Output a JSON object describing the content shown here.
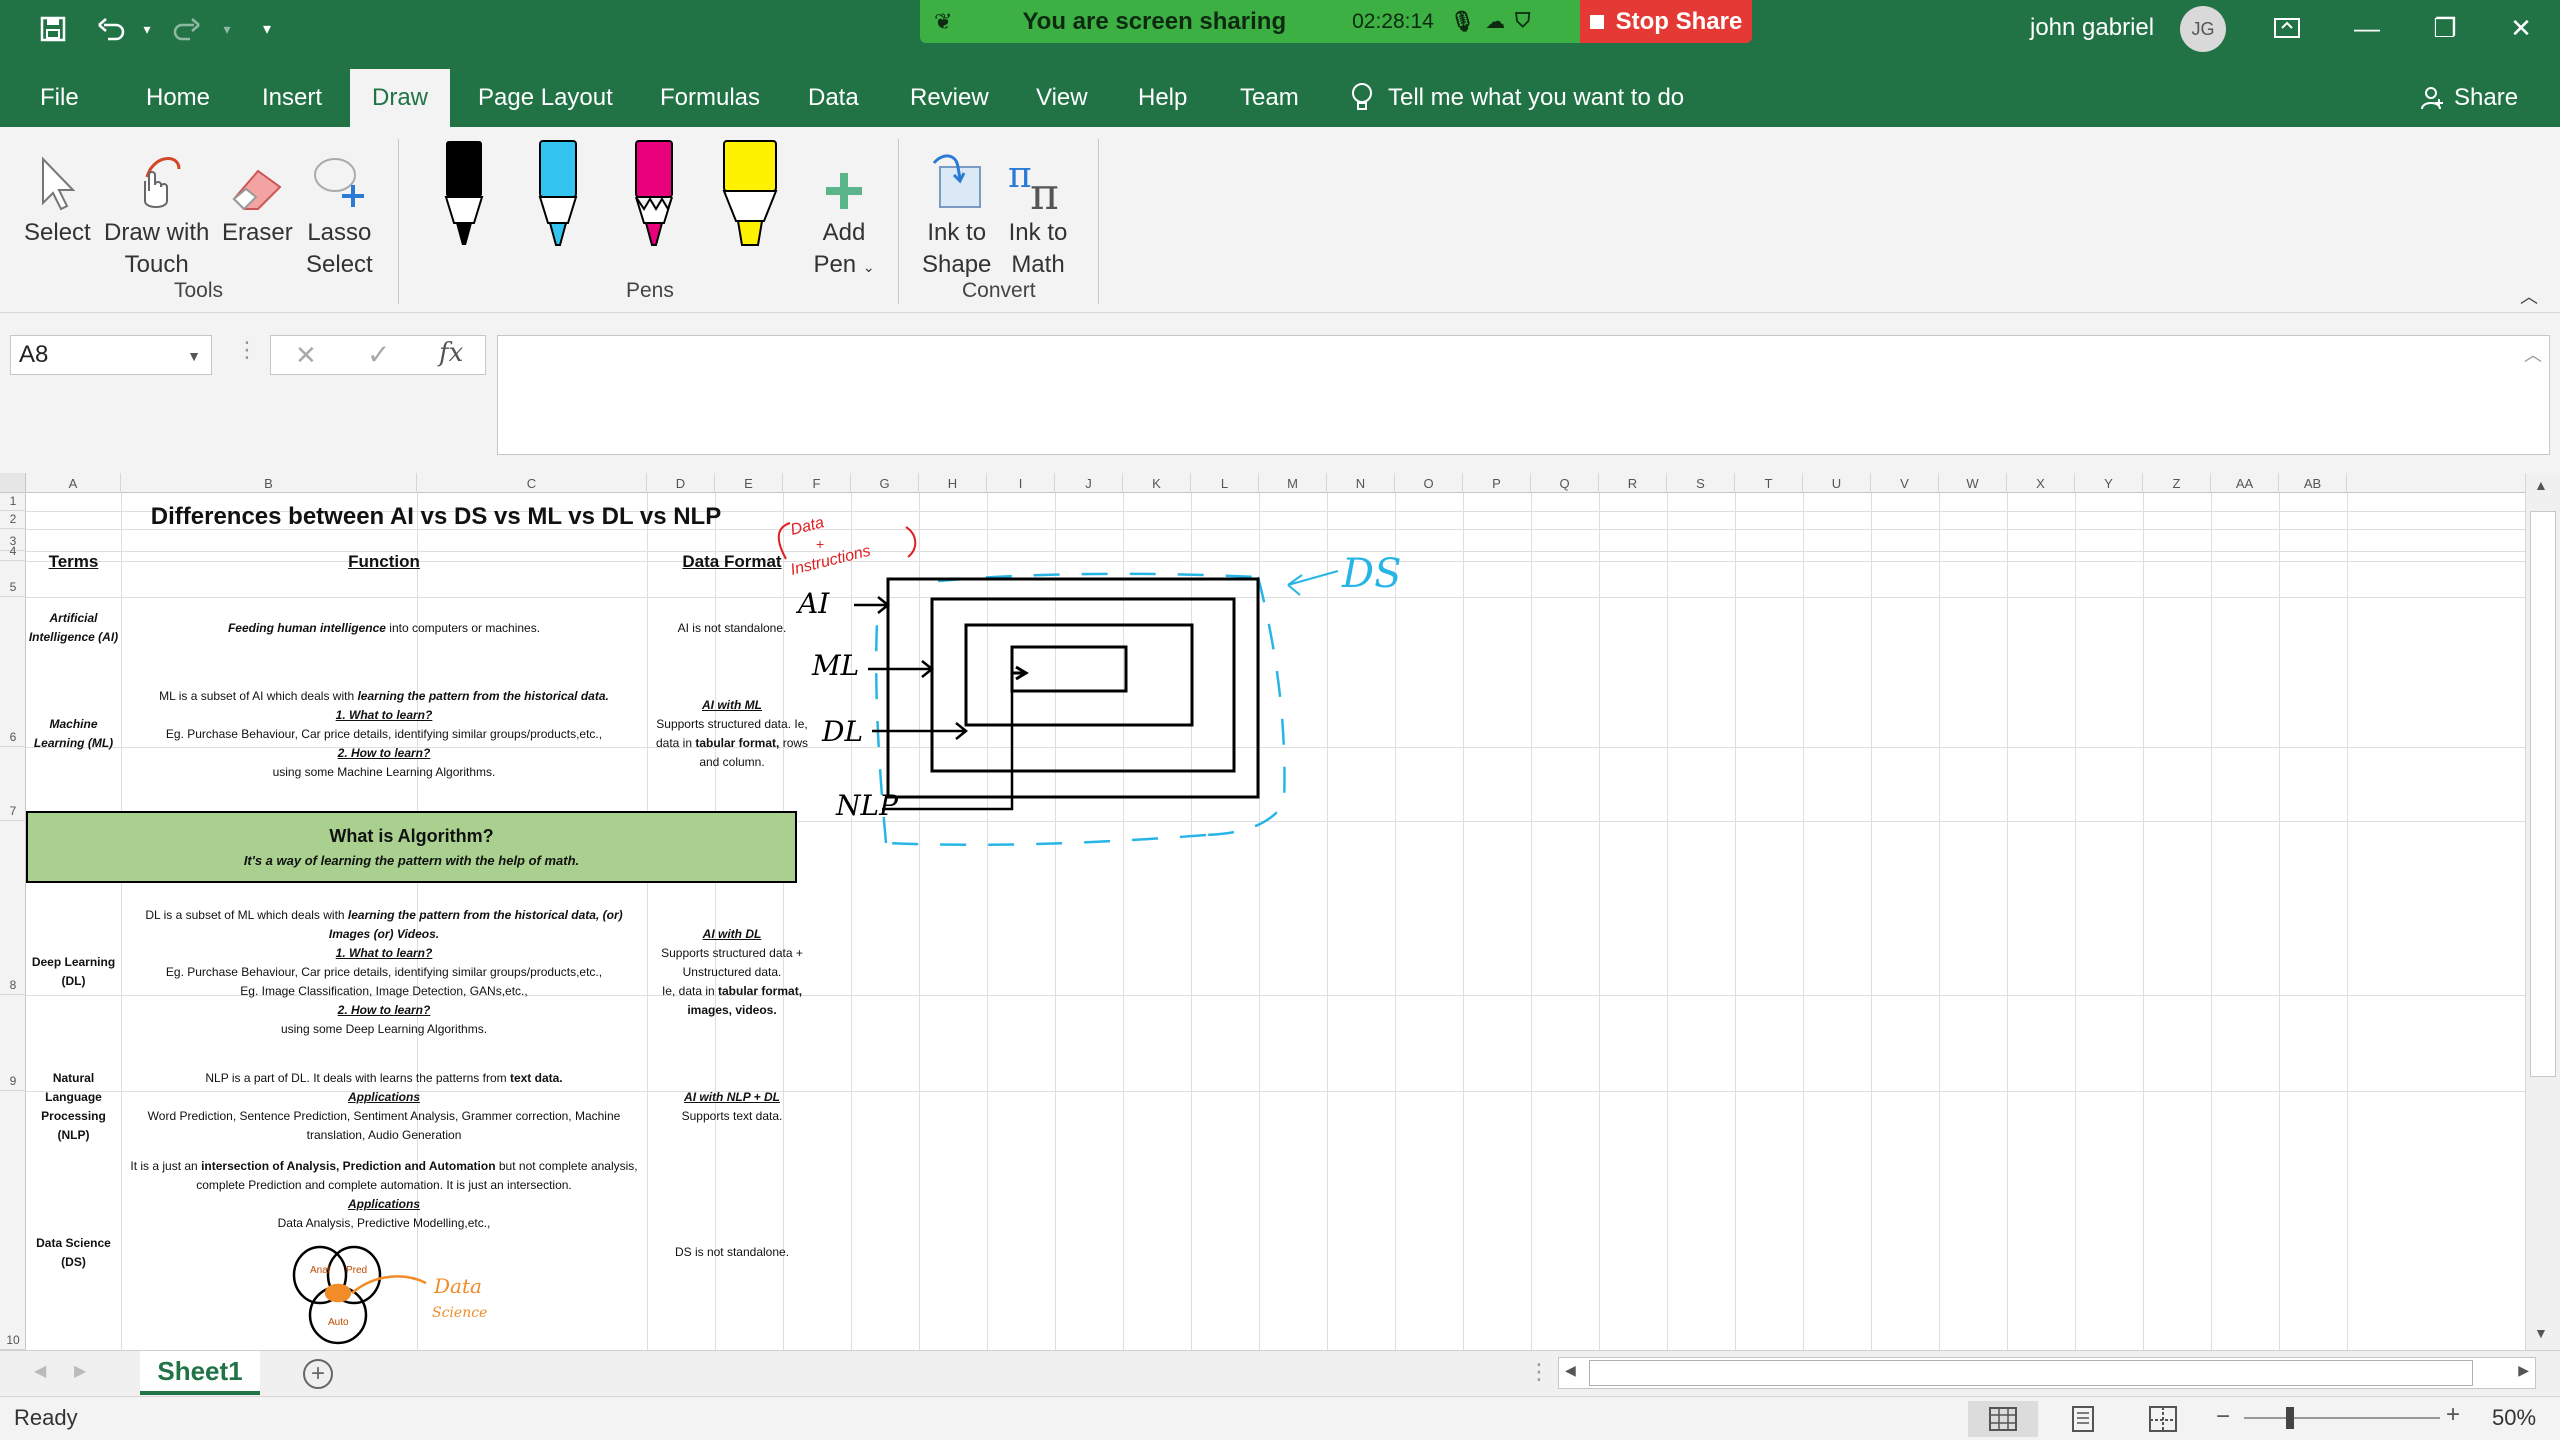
{
  "window": {
    "user_name": "john gabriel",
    "user_initials": "JG",
    "sharing_text": "You are screen sharing",
    "sharing_timer": "02:28:14",
    "stop_share_label": "Stop Share"
  },
  "menu": {
    "tabs": [
      "File",
      "Home",
      "Insert",
      "Draw",
      "Page Layout",
      "Formulas",
      "Data",
      "Review",
      "View",
      "Help",
      "Team"
    ],
    "active_tab": "Draw",
    "tell_me": "Tell me what you want to do",
    "share": "Share"
  },
  "ribbon": {
    "tools": {
      "select": "Select",
      "draw_touch_1": "Draw with",
      "draw_touch_2": "Touch",
      "eraser": "Eraser",
      "lasso_1": "Lasso",
      "lasso_2": "Select",
      "group": "Tools"
    },
    "pens": {
      "add_pen_1": "Add",
      "add_pen_2": "Pen",
      "group": "Pens",
      "colors": [
        "#000000",
        "#33c4f0",
        "#e8007d",
        "#fff200"
      ]
    },
    "convert": {
      "ink_shape_1": "Ink to",
      "ink_shape_2": "Shape",
      "ink_math_1": "Ink to",
      "ink_math_2": "Math",
      "group": "Convert"
    }
  },
  "formula_bar": {
    "name_box": "A8",
    "fx": "fx",
    "value": ""
  },
  "sheet": {
    "columns": [
      "A",
      "B",
      "C",
      "D",
      "E",
      "F",
      "G",
      "H",
      "I",
      "J",
      "K",
      "L",
      "M",
      "N",
      "O",
      "P",
      "Q",
      "R",
      "S",
      "T",
      "U",
      "V",
      "W",
      "X",
      "Y",
      "Z",
      "AA",
      "AB"
    ],
    "rows": [
      "1",
      "2",
      "3",
      "4",
      "5",
      "6",
      "7",
      "8",
      "9",
      "10"
    ],
    "title": "Differences between AI vs DS vs ML vs DL vs NLP",
    "headers": {
      "terms": "Terms",
      "function": "Function",
      "data_format": "Data Format"
    },
    "ai": {
      "term": "Artificial Intelligence (AI)",
      "function_bold": "Feeding human intelligence",
      "function_rest": " into computers or machines.",
      "format": "AI is not standalone."
    },
    "ml": {
      "term": "Machine Learning (ML)",
      "line1": "ML is a subset of AI which deals with ",
      "line1_bold": "learning the pattern from the historical data.",
      "q1": "1. What to learn?",
      "q1_text": "Eg. Purchase Behaviour, Car price details, identifying similar groups/products,etc.,",
      "q2": "2. How to learn?",
      "q2_text": "using some Machine Learning Algorithms.",
      "format_title": "AI with ML",
      "format_text": "Supports structured data. Ie, data in ",
      "format_bold": "tabular format,",
      "format_rest": " rows and column."
    },
    "algorithm": {
      "title": "What is Algorithm?",
      "subtitle": "It's a way of learning the pattern with the help of math."
    },
    "dl": {
      "term": "Deep Learning (DL)",
      "line1": "DL is a subset of ML which deals with ",
      "line1_bold": "learning the pattern from the historical data, (or) Images (or) Videos.",
      "q1": "1. What to learn?",
      "q1_text": "Eg. Purchase Behaviour, Car price details, identifying similar groups/products,etc.,",
      "q1_text2": "Eg. Image Classification, Image Detection, GANs,etc.,",
      "q2": "2. How to learn?",
      "q2_text": "using some Deep Learning Algorithms.",
      "format_title": "AI with DL",
      "format_text": "Supports structured data + Unstructured data.",
      "format_text2": "Ie, data in ",
      "format_bold": "tabular format, images, videos."
    },
    "nlp": {
      "term": "Natural Language Processing (NLP)",
      "line1": "NLP is a part of DL. It deals with learns the patterns from ",
      "line1_bold": "text data.",
      "apps": "Applications",
      "apps_text": "Word Prediction, Sentence Prediction, Sentiment Analysis, Grammer correction, Machine translation, Audio Generation",
      "format_title": "AI with NLP + DL",
      "format_text": "Supports text data."
    },
    "ds": {
      "term": "Data Science (DS)",
      "line1": "It is a just an ",
      "line1_bold": "intersection of Analysis, Prediction and Automation",
      "line1_rest": " but not complete analysis, complete Prediction and complete automation. It is just an intersection.",
      "apps": "Applications",
      "apps_text": "Data Analysis, Predictive Modelling,etc.,",
      "format": "DS is not standalone."
    },
    "ink": {
      "data_instructions_1": "Data",
      "data_instructions_2": "+",
      "data_instructions_3": "Instructions",
      "ai": "AI",
      "ml": "ML",
      "dl": "DL",
      "nlp": "NLP",
      "ds": "DS",
      "venn_a": "Anal",
      "venn_b": "Pred",
      "venn_c": "Auto",
      "venn_label_1": "Data",
      "venn_label_2": "Science"
    }
  },
  "tabs": {
    "sheet1": "Sheet1"
  },
  "status": {
    "ready": "Ready",
    "zoom": "50%"
  }
}
